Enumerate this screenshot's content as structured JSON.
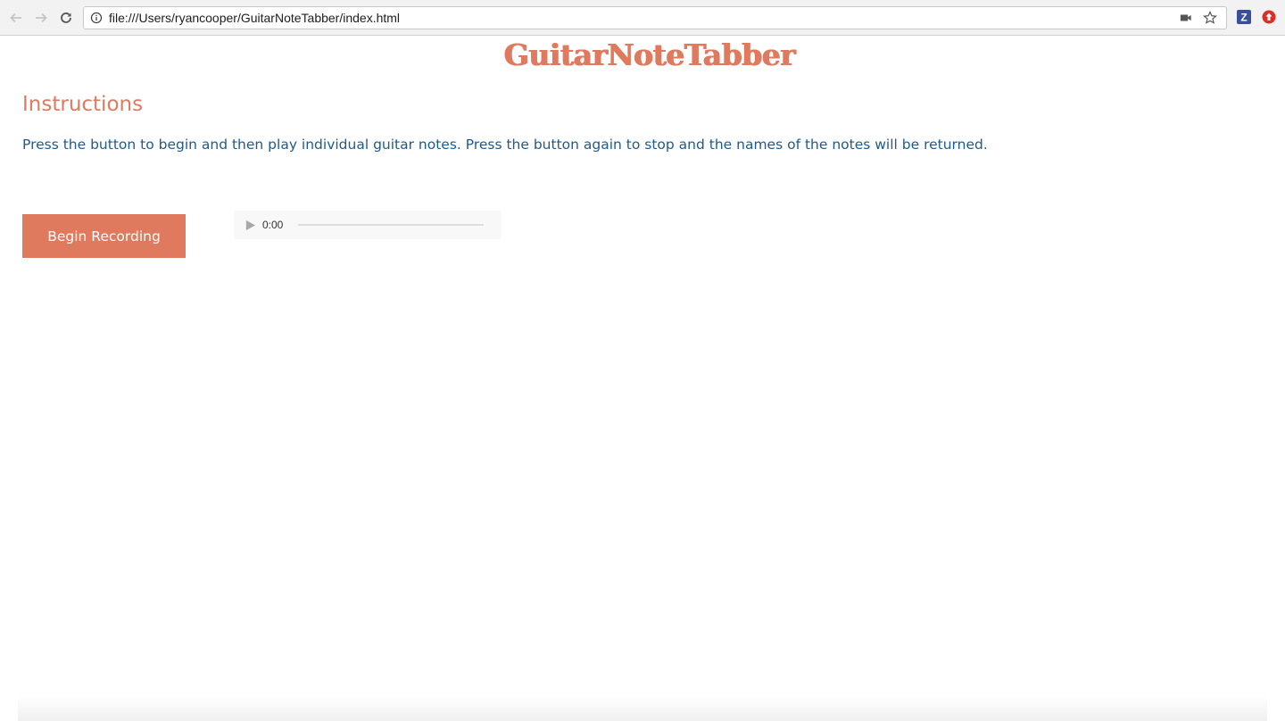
{
  "browser": {
    "url": "file:///Users/ryancooper/GuitarNoteTabber/index.html",
    "extension_z_label": "Z"
  },
  "site": {
    "title": "GuitarNoteTabber",
    "title_color": "#e07a5f"
  },
  "instructions": {
    "heading": "Instructions",
    "text": "Press the button to begin and then play individual guitar notes. Press the button again to stop and the names of the notes will be returned."
  },
  "controls": {
    "record_button_label": "Begin Recording",
    "audio_time": "0:00"
  },
  "colors": {
    "accent": "#e07a5f",
    "text_blue": "#1f5a8c"
  }
}
